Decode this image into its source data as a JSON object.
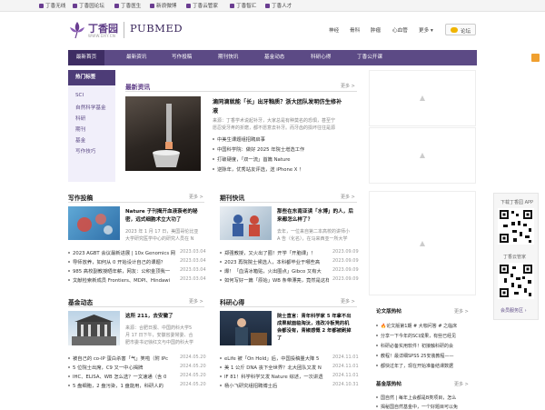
{
  "topbar": {
    "links": [
      "丁香无线",
      "丁香园论坛",
      "丁香医生",
      "新浪微博",
      "丁香云管家",
      "丁香智汇",
      "丁香人才"
    ]
  },
  "header": {
    "logo_cn": "丁香园",
    "logo_en": "WWW.DXY.CN",
    "logo_product": "PUBMED",
    "nav": [
      "神经",
      "骨科",
      "肿瘤",
      "心血管",
      "更多 ▾"
    ],
    "login_label": "论坛"
  },
  "navbar": {
    "items": [
      "最新首页",
      "最新资讯",
      "写作投稿",
      "期刊快讯",
      "基金动态",
      "科研心得",
      "丁香公开课"
    ]
  },
  "hot_tags": {
    "title": "热门标签",
    "items": [
      "SCI",
      "自然科学基金",
      "科研",
      "期刊",
      "基金",
      "写作技巧"
    ]
  },
  "latest": {
    "title": "最新资讯",
    "more": "更多 >",
    "headline_1": "滴同滴就能「长」出牙釉质？浙大团队发明仿生修补",
    "headline_2": "液",
    "summary_1": "来源：丁香学术说起补牙，大家总是有种莫名的恐惧，甚至宁",
    "summary_2": "愿忍受牙疼的折磨，都不愿意去补牙。而牙齿的损坏往往是源",
    "items": [
      "中美生课题组招聘启事",
      "中国科学院：做好 2025 年院士增选工作",
      "打破硬度，「双一流」首篇 Nature",
      "逆脉年，优秀站友评选，送 iPhone X ！"
    ]
  },
  "writing": {
    "title": "写作投稿",
    "more": "更多 >",
    "headline_1": "Nature 子刊揭开血液衰老的秘",
    "headline_2": "密，远式细胞术立大功了",
    "summary_1": "2023 年 1 月 17 日，美国哥伦比亚",
    "summary_2": "大学研究医学中心的研究人员在 N",
    "list": [
      {
        "text": "2023 AGBT 会议最新进展 | 10x Genomics 网",
        "date": "2023.03.04"
      },
      {
        "text": "导师放养，如何从 0 开始设计自己的课题？",
        "date": "2023.03.04"
      },
      {
        "text": "985 高校副教授晒年薪，网友：公积金顶我一",
        "date": "2023.03.04"
      },
      {
        "text": "文献检索新成员 Frontiers、MDPI、Hindawi",
        "date": "2023.03.04"
      }
    ]
  },
  "journal": {
    "title": "期刊快讯",
    "more": "更多 >",
    "headline_1": "那些在东南亚读「水博」的人，后",
    "headline_2": "来都怎么样了？",
    "summary_1": "去年，一位来自第二本高校的讲师小",
    "summary_2": "A 告（化名），在马来西亚一所大学",
    "list": [
      {
        "text": "郑强教授，又火出了圈！开学「开脑课」！",
        "date": "2023.09.09"
      },
      {
        "text": "2023 再院院士候选人，本科都毕业于哪些高",
        "date": "2023.09.09"
      },
      {
        "text": "爆！「血清冰箱贴，火出圈点」Gibco 又有大",
        "date": "2023.09.09"
      },
      {
        "text": "如何写好一篇「原始」WB 条带漂亮，竟然是这样做",
        "date": "2023.09.09"
      }
    ]
  },
  "fund": {
    "title": "基金动态",
    "more": "更多 >",
    "headline_1": "这所 211，去安徽了",
    "summary_1": "来源：合肥日报、中国药科大学5",
    "summary_2": "月 17 日下午，安徽省委常委、合",
    "summary_3": "肥市委书记徐红文与中国药科大学",
    "list": [
      {
        "text": "被自己的 co-IP 蛋白杀害「气」笑啦（附 IPc",
        "date": "2024.05.20"
      },
      {
        "text": "5 位院士出席，C9 又一中心揭牌",
        "date": "2024.05.20"
      },
      {
        "text": "IHC、ELISA、WB 怎么选？一文速通（含 0",
        "date": "2024.05.20"
      },
      {
        "text": "5 盘细胞，2 盘污染，1 盘能用，科研人的",
        "date": "2024.05.20"
      }
    ]
  },
  "research": {
    "title": "科研心得",
    "more": "更多 >",
    "headline_1": "院士直言：青年科学家 5 年拿不出",
    "headline_2": "成果就面临淘汰，违改冷板凳的机",
    "headline_3": "会都没有，青椒感慨 2 年都被刷掉",
    "headline_4": "了",
    "list": [
      {
        "text": "eLife 被「On Hold」后，中国投稿量大降 5",
        "date": "2024.11.01"
      },
      {
        "text": "美 1 公斤 DNA 丧下全世界？北大团队又发 N",
        "date": "2024.11.01"
      },
      {
        "text": "IF 81！科学科学又发 Nature 综述，一次讲透",
        "date": "2024.11.01"
      },
      {
        "text": "杨小飞研究组招聘博士后",
        "date": "2024.10.31"
      }
    ]
  },
  "sidebar": {
    "app_label": "下载丁香园 APP",
    "app2_label": "丁香云管家",
    "forum_link": "会员服务区 ›",
    "forum": {
      "title": "论文版热帖",
      "more": "更多 >",
      "items": [
        "🔥论文版第1期 # 大咖问答 # 之临床",
        "分享一下今年的SCI成果，有些已经见",
        "科研必备实用软件！初接触科研的会",
        "教程！最详细SPSS 25安装教程——",
        "都快过年了，现在开始准备结课数据"
      ]
    },
    "fund_board": {
      "title": "基金版热帖",
      "more": "更多 >",
      "items": [
        "国自然 | 每年上会都是B类项目，怎么",
        "揭秘国自然基金中，一个好题目可以免"
      ]
    }
  }
}
